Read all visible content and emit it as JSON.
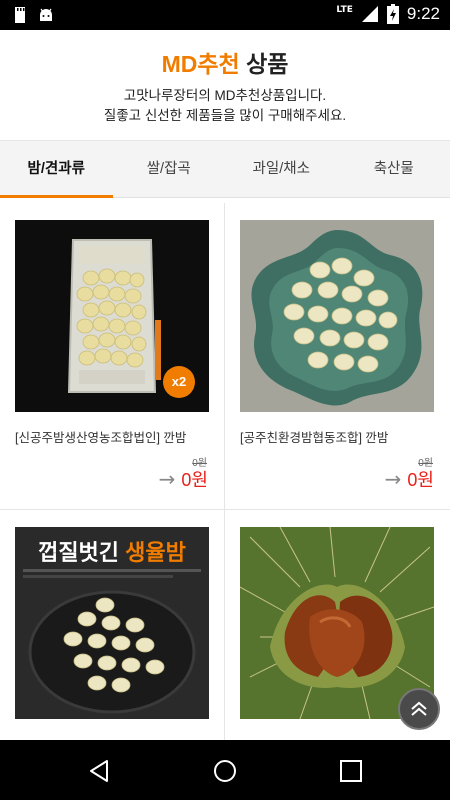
{
  "status_bar": {
    "time": "9:22",
    "network": "LTE",
    "icons": [
      "sd-card-icon",
      "android-icon",
      "signal-icon",
      "battery-icon"
    ]
  },
  "header": {
    "title_accent": "MD추천",
    "title_rest": "상품",
    "subtitle_line1": "고맛나루장터의 MD추천상품입니다.",
    "subtitle_line2": "질좋고 신선한 제품들을 많이 구매해주세요."
  },
  "tabs": [
    {
      "label": "밤/견과류",
      "active": true
    },
    {
      "label": "쌀/잡곡",
      "active": false
    },
    {
      "label": "과일/채소",
      "active": false
    },
    {
      "label": "축산물",
      "active": false
    }
  ],
  "products": [
    {
      "name": "[신공주밤생산영농조합법인] 깐밤",
      "original_price": "0원",
      "price": "0원",
      "badge": "x2"
    },
    {
      "name": "[공주친환경밤협동조합] 깐밤",
      "original_price": "0원",
      "price": "0원"
    },
    {
      "banner_white": "껍질벗긴",
      "banner_orange": "생율밤"
    },
    {}
  ],
  "colors": {
    "accent": "#f07c00",
    "price": "#e8211a",
    "tab_bg": "#f4f4f4"
  }
}
